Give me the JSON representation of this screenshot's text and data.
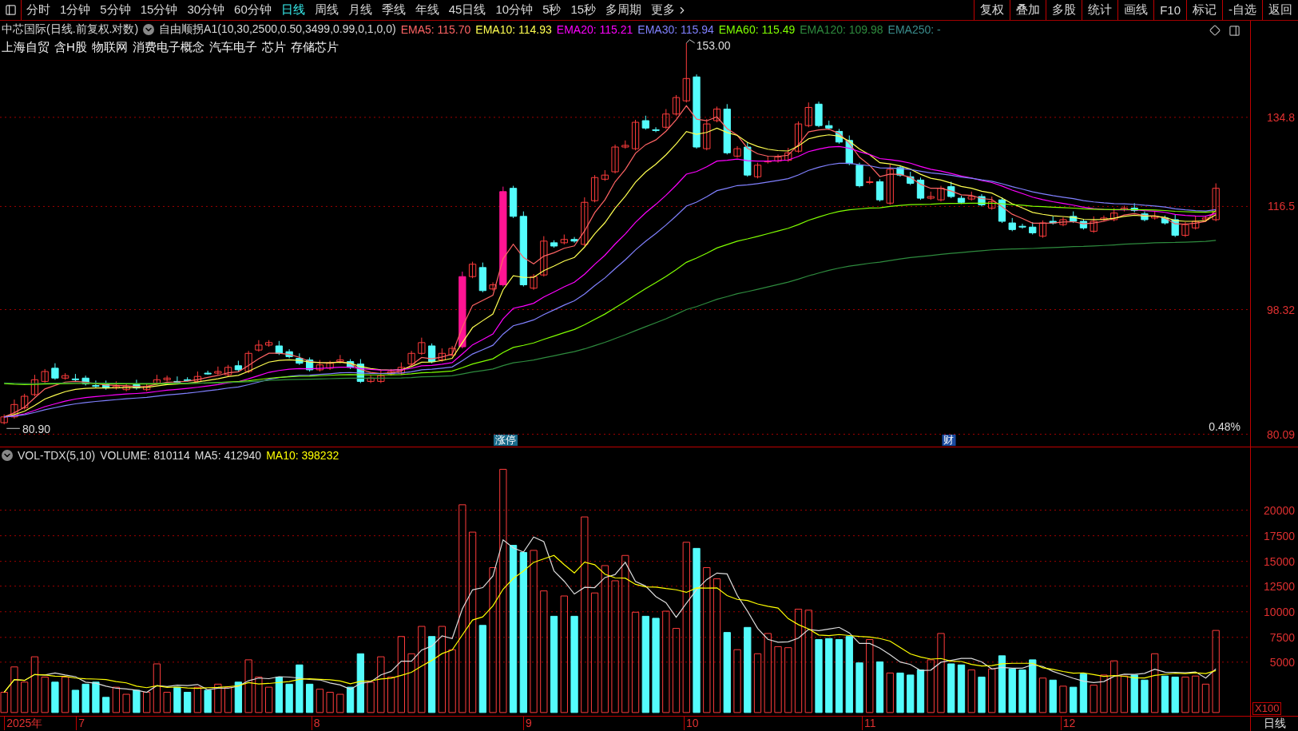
{
  "toolbar": {
    "periods": [
      {
        "label": "分时",
        "selected": false
      },
      {
        "label": "1分钟",
        "selected": false
      },
      {
        "label": "5分钟",
        "selected": false
      },
      {
        "label": "15分钟",
        "selected": false
      },
      {
        "label": "30分钟",
        "selected": false
      },
      {
        "label": "60分钟",
        "selected": false
      },
      {
        "label": "日线",
        "selected": true
      },
      {
        "label": "周线",
        "selected": false
      },
      {
        "label": "月线",
        "selected": false
      },
      {
        "label": "季线",
        "selected": false
      },
      {
        "label": "年线",
        "selected": false
      },
      {
        "label": "45日线",
        "selected": false
      },
      {
        "label": "10分钟",
        "selected": false
      },
      {
        "label": "5秒",
        "selected": false
      },
      {
        "label": "15秒",
        "selected": false
      },
      {
        "label": "多周期",
        "selected": false
      }
    ],
    "more": "更多",
    "buttons": [
      "复权",
      "叠加",
      "多股",
      "统计",
      "画线",
      "F10",
      "标记",
      "-自选",
      "返回"
    ]
  },
  "price_panel": {
    "title": "中芯国际(日线.前复权.对数)",
    "formula": "自由顺拐A1(10,30,2500,0.50,3499,0.99,0,1,0,0)",
    "indicators": [
      {
        "label": "EMA5: 115.70",
        "color": "#ff6464"
      },
      {
        "label": "EMA10: 114.93",
        "color": "#ffff50"
      },
      {
        "label": "EMA20: 115.21",
        "color": "#ff00ff"
      },
      {
        "label": "EMA30: 115.94",
        "color": "#8080ff"
      },
      {
        "label": "EMA60: 115.49",
        "color": "#80ff00"
      },
      {
        "label": "EMA120: 109.98",
        "color": "#2e8b3e"
      },
      {
        "label": "EMA250: -",
        "color": "#3a8c8c"
      }
    ],
    "tags": [
      "上海自贸",
      "含H股",
      "物联网",
      "消费电子概念",
      "汽车电子",
      "芯片",
      "存储芯片"
    ],
    "axis_labels": [
      "134.8",
      "116.5",
      "98.32",
      "80.09"
    ],
    "high_label": "153.00",
    "low_label": "80.90",
    "change": "0.48%",
    "markers": [
      "涨停",
      "财"
    ]
  },
  "volume_panel": {
    "title": "VOL-TDX(5,10)",
    "readings": [
      {
        "label": "VOLUME: 810114",
        "color": "#dcdcdc"
      },
      {
        "label": "MA5: 412940",
        "color": "#dcdcdc"
      },
      {
        "label": "MA10: 398232",
        "color": "#ffff00"
      }
    ],
    "unit": "X100",
    "axis_labels": [
      "20000",
      "17500",
      "15000",
      "12500",
      "10000",
      "7500",
      "5000"
    ]
  },
  "date_axis": {
    "labels": [
      "2025年",
      "7",
      "8",
      "9",
      "10",
      "11",
      "12"
    ],
    "period": "日线"
  }
}
